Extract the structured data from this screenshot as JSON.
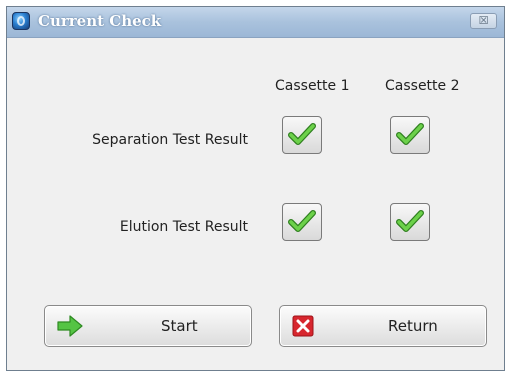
{
  "window": {
    "title": "Current Check",
    "close_glyph": "☒"
  },
  "columns": [
    "Cassette 1",
    "Cassette 2"
  ],
  "rows": [
    {
      "label": "Separation Test Result",
      "results": [
        "pass",
        "pass"
      ]
    },
    {
      "label": "Elution Test Result",
      "results": [
        "pass",
        "pass"
      ]
    }
  ],
  "buttons": {
    "start_label": "Start",
    "return_label": "Return"
  },
  "icons": {
    "title": "app-logo-icon",
    "check": "green-checkmark-icon",
    "start": "green-arrow-right-icon",
    "return": "red-x-icon"
  },
  "colors": {
    "titlebar": "#a9c2dd",
    "check_green": "#5cc240",
    "start_arrow": "#4cb840",
    "return_red": "#d7262e"
  }
}
